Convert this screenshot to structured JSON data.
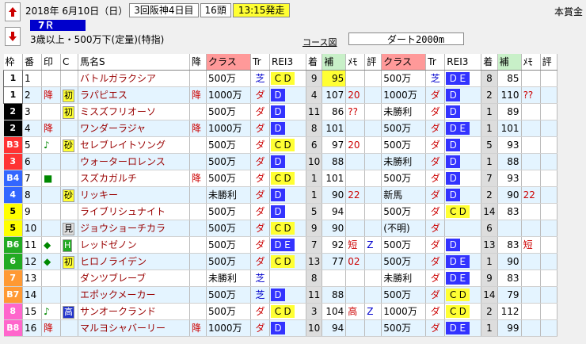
{
  "header": {
    "date": "2018年  6月10日（日）",
    "meeting": "3回阪神4日目",
    "heads": "16頭",
    "start": "13:15発走",
    "prize_label": "本賞金",
    "race_no": "7Ｒ",
    "condition": "3歳以上・500万下(定量)(特指)",
    "course_label": "コース図",
    "course": "ダート2000m"
  },
  "columns": [
    "枠",
    "番",
    "印",
    "C",
    "馬名S",
    "降",
    "クラス",
    "Tr",
    "REI3",
    "着",
    "補",
    "ﾒﾓ",
    "評",
    "クラス",
    "Tr",
    "REI3",
    "着",
    "補",
    "ﾒﾓ",
    "評"
  ],
  "rows": [
    {
      "waku": "1",
      "wc": "#ffffff",
      "wt": "#000",
      "ban": "1",
      "in": "",
      "c": "",
      "cm": "",
      "name": "バトルガラクシア",
      "kou": "",
      "c1": "500万",
      "t1": "芝",
      "r1": "ＣＤ",
      "r1t": "cd",
      "ch1": "9",
      "h1": "95",
      "h1y": true,
      "m1": "",
      "e1": "",
      "c2": "500万",
      "t2": "芝",
      "r2": "ＤＥ",
      "r2t": "de",
      "ch2": "8",
      "h2": "85",
      "h2y": false,
      "m2": "",
      "e2": ""
    },
    {
      "waku": "1",
      "wc": "#ffffff",
      "wt": "#000",
      "ban": "2",
      "in": "降",
      "c": "初",
      "cm": "y",
      "name": "ラパピエス",
      "kou": "降",
      "c1": "1000万",
      "t1": "ダ",
      "r1": "Ｄ",
      "r1t": "d",
      "ch1": "4",
      "h1": "107",
      "h1y": false,
      "m1": "20",
      "e1": "",
      "c2": "1000万",
      "t2": "ダ",
      "r2": "Ｄ",
      "r2t": "d",
      "ch2": "2",
      "h2": "110",
      "h2y": false,
      "m2": "??",
      "e2": ""
    },
    {
      "waku": "2",
      "wc": "#000000",
      "wt": "#fff",
      "ban": "3",
      "in": "",
      "c": "初",
      "cm": "y",
      "name": "ミスズフリオーソ",
      "kou": "",
      "c1": "500万",
      "t1": "ダ",
      "r1": "Ｄ",
      "r1t": "d",
      "ch1": "11",
      "h1": "86",
      "h1y": false,
      "m1": "??",
      "e1": "",
      "c2": "未勝利",
      "t2": "ダ",
      "r2": "Ｄ",
      "r2t": "d",
      "ch2": "1",
      "h2": "89",
      "h2y": false,
      "m2": "",
      "e2": ""
    },
    {
      "waku": "2",
      "wc": "#000000",
      "wt": "#fff",
      "ban": "4",
      "in": "降",
      "c": "",
      "cm": "",
      "name": "ワンダーラジャ",
      "kou": "降",
      "c1": "1000万",
      "t1": "ダ",
      "r1": "Ｄ",
      "r1t": "d",
      "ch1": "8",
      "h1": "101",
      "h1y": false,
      "m1": "",
      "e1": "",
      "c2": "500万",
      "t2": "ダ",
      "r2": "ＤＥ",
      "r2t": "de",
      "ch2": "1",
      "h2": "101",
      "h2y": false,
      "m2": "",
      "e2": ""
    },
    {
      "waku": "B3",
      "wc": "#ff3333",
      "wt": "#fff",
      "ban": "5",
      "in": "♪",
      "c": "砂",
      "cm": "y",
      "name": "セレブレイトソング",
      "kou": "",
      "c1": "500万",
      "t1": "ダ",
      "r1": "ＣＤ",
      "r1t": "cd",
      "ch1": "6",
      "h1": "97",
      "h1y": false,
      "m1": "20",
      "e1": "",
      "c2": "500万",
      "t2": "ダ",
      "r2": "Ｄ",
      "r2t": "d",
      "ch2": "5",
      "h2": "93",
      "h2y": false,
      "m2": "",
      "e2": ""
    },
    {
      "waku": "3",
      "wc": "#ff3333",
      "wt": "#fff",
      "ban": "6",
      "in": "",
      "c": "",
      "cm": "",
      "name": "ウォーターロレンス",
      "kou": "",
      "c1": "500万",
      "t1": "ダ",
      "r1": "Ｄ",
      "r1t": "d",
      "ch1": "10",
      "h1": "88",
      "h1y": false,
      "m1": "",
      "e1": "",
      "c2": "未勝利",
      "t2": "ダ",
      "r2": "Ｄ",
      "r2t": "d",
      "ch2": "1",
      "h2": "88",
      "h2y": false,
      "m2": "",
      "e2": ""
    },
    {
      "waku": "B4",
      "wc": "#3366ff",
      "wt": "#fff",
      "ban": "7",
      "in": "■",
      "c": "",
      "cm": "",
      "name": "スズカガルチ",
      "kou": "降",
      "c1": "500万",
      "t1": "ダ",
      "r1": "ＣＤ",
      "r1t": "cd",
      "ch1": "1",
      "h1": "101",
      "h1y": false,
      "m1": "",
      "e1": "",
      "c2": "500万",
      "t2": "ダ",
      "r2": "Ｄ",
      "r2t": "d",
      "ch2": "7",
      "h2": "93",
      "h2y": false,
      "m2": "",
      "e2": ""
    },
    {
      "waku": "4",
      "wc": "#3366ff",
      "wt": "#fff",
      "ban": "8",
      "in": "",
      "c": "砂",
      "cm": "y",
      "name": "リッキー",
      "kou": "",
      "c1": "未勝利",
      "t1": "ダ",
      "r1": "Ｄ",
      "r1t": "d",
      "ch1": "1",
      "h1": "90",
      "h1y": false,
      "m1": "22",
      "e1": "",
      "c2": "新馬",
      "t2": "ダ",
      "r2": "Ｄ",
      "r2t": "d",
      "ch2": "2",
      "h2": "90",
      "h2y": false,
      "m2": "22",
      "e2": ""
    },
    {
      "waku": "5",
      "wc": "#ffff00",
      "wt": "#000",
      "ban": "9",
      "in": "",
      "c": "",
      "cm": "",
      "name": "ライブリシュナイト",
      "kou": "",
      "c1": "500万",
      "t1": "ダ",
      "r1": "Ｄ",
      "r1t": "d",
      "ch1": "5",
      "h1": "94",
      "h1y": false,
      "m1": "",
      "e1": "",
      "c2": "500万",
      "t2": "ダ",
      "r2": "ＣＤ",
      "r2t": "cd",
      "ch2": "14",
      "h2": "83",
      "h2y": false,
      "m2": "",
      "e2": ""
    },
    {
      "waku": "5",
      "wc": "#ffff00",
      "wt": "#000",
      "ban": "10",
      "in": "",
      "c": "見",
      "cm": "gray",
      "name": "ジョウショーチカラ",
      "kou": "",
      "c1": "500万",
      "t1": "ダ",
      "r1": "ＣＤ",
      "r1t": "cd",
      "ch1": "9",
      "h1": "90",
      "h1y": false,
      "m1": "",
      "e1": "",
      "c2": "(不明)",
      "t2": "ダ",
      "r2": "",
      "r2t": "",
      "ch2": "6",
      "h2": "",
      "h2y": false,
      "m2": "",
      "e2": ""
    },
    {
      "waku": "B6",
      "wc": "#22aa22",
      "wt": "#fff",
      "ban": "11",
      "in": "◆",
      "c": "H",
      "cm": "g",
      "name": "レッドゼノン",
      "kou": "",
      "c1": "500万",
      "t1": "ダ",
      "r1": "ＤＥ",
      "r1t": "de",
      "ch1": "7",
      "h1": "92",
      "h1y": false,
      "m1": "短",
      "e1": "Z",
      "c2": "500万",
      "t2": "ダ",
      "r2": "Ｄ",
      "r2t": "d",
      "ch2": "13",
      "h2": "83",
      "h2y": false,
      "m2": "短",
      "e2": ""
    },
    {
      "waku": "6",
      "wc": "#22aa22",
      "wt": "#fff",
      "ban": "12",
      "in": "◆",
      "c": "初",
      "cm": "y",
      "name": "ヒロノライデン",
      "kou": "",
      "c1": "500万",
      "t1": "ダ",
      "r1": "ＣＤ",
      "r1t": "cd",
      "ch1": "13",
      "h1": "77",
      "h1y": false,
      "m1": "02",
      "e1": "",
      "c2": "500万",
      "t2": "ダ",
      "r2": "ＤＥ",
      "r2t": "de",
      "ch2": "1",
      "h2": "90",
      "h2y": false,
      "m2": "",
      "e2": ""
    },
    {
      "waku": "7",
      "wc": "#ff9933",
      "wt": "#fff",
      "ban": "13",
      "in": "",
      "c": "",
      "cm": "",
      "name": "ダンツブレーブ",
      "kou": "",
      "c1": "未勝利",
      "t1": "芝",
      "r1": "",
      "r1t": "",
      "ch1": "8",
      "h1": "",
      "h1y": false,
      "m1": "",
      "e1": "",
      "c2": "未勝利",
      "t2": "ダ",
      "r2": "ＤＥ",
      "r2t": "de",
      "ch2": "9",
      "h2": "83",
      "h2y": false,
      "m2": "",
      "e2": ""
    },
    {
      "waku": "B7",
      "wc": "#ff9933",
      "wt": "#fff",
      "ban": "14",
      "in": "",
      "c": "",
      "cm": "",
      "name": "エポックメーカー",
      "kou": "",
      "c1": "500万",
      "t1": "芝",
      "r1": "Ｄ",
      "r1t": "d",
      "ch1": "11",
      "h1": "88",
      "h1y": false,
      "m1": "",
      "e1": "",
      "c2": "500万",
      "t2": "ダ",
      "r2": "ＣＤ",
      "r2t": "cd",
      "ch2": "14",
      "h2": "79",
      "h2y": false,
      "m2": "",
      "e2": ""
    },
    {
      "waku": "8",
      "wc": "#ff66cc",
      "wt": "#fff",
      "ban": "15",
      "in": "♪",
      "c": "高",
      "cm": "b",
      "name": "サンオークランド",
      "kou": "",
      "c1": "500万",
      "t1": "ダ",
      "r1": "ＣＤ",
      "r1t": "cd",
      "ch1": "3",
      "h1": "104",
      "h1y": false,
      "m1": "高",
      "e1": "Z",
      "c2": "1000万",
      "t2": "ダ",
      "r2": "ＣＤ",
      "r2t": "cd",
      "ch2": "2",
      "h2": "112",
      "h2y": false,
      "m2": "",
      "e2": ""
    },
    {
      "waku": "B8",
      "wc": "#ff66cc",
      "wt": "#fff",
      "ban": "16",
      "in": "降",
      "c": "",
      "cm": "",
      "name": "マルヨシャバーリー",
      "kou": "降",
      "c1": "1000万",
      "t1": "ダ",
      "r1": "Ｄ",
      "r1t": "d",
      "ch1": "10",
      "h1": "94",
      "h1y": false,
      "m1": "",
      "e1": "",
      "c2": "500万",
      "t2": "ダ",
      "r2": "ＤＥ",
      "r2t": "de",
      "ch2": "1",
      "h2": "99",
      "h2y": false,
      "m2": "",
      "e2": ""
    }
  ]
}
